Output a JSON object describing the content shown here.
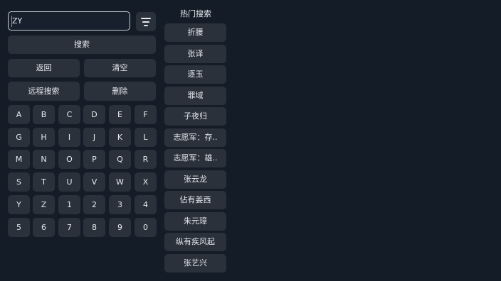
{
  "search": {
    "value": "ZY"
  },
  "buttons": {
    "search": "搜索",
    "back": "返回",
    "clear": "清空",
    "remote_search": "远程搜索",
    "delete": "删除"
  },
  "keyboard": {
    "keys": [
      "A",
      "B",
      "C",
      "D",
      "E",
      "F",
      "G",
      "H",
      "I",
      "J",
      "K",
      "L",
      "M",
      "N",
      "O",
      "P",
      "Q",
      "R",
      "S",
      "T",
      "U",
      "V",
      "W",
      "X",
      "Y",
      "Z",
      "1",
      "2",
      "3",
      "4",
      "5",
      "6",
      "7",
      "8",
      "9",
      "0"
    ]
  },
  "hot": {
    "title": "热门搜索",
    "items": [
      "折腰",
      "张译",
      "逐玉",
      "罪域",
      "子夜归",
      "志愿军：存..",
      "志愿军：雄..",
      "张云龙",
      "佔有姜西",
      "朱元璋",
      "纵有疾风起",
      "张艺兴"
    ]
  },
  "icons": {
    "filter": "filter-icon"
  },
  "colors": {
    "background": "#141c27",
    "button": "#2a313b",
    "text": "#e6e9ee",
    "input_border": "#c9ced6",
    "caret": "#3fb3c8"
  }
}
